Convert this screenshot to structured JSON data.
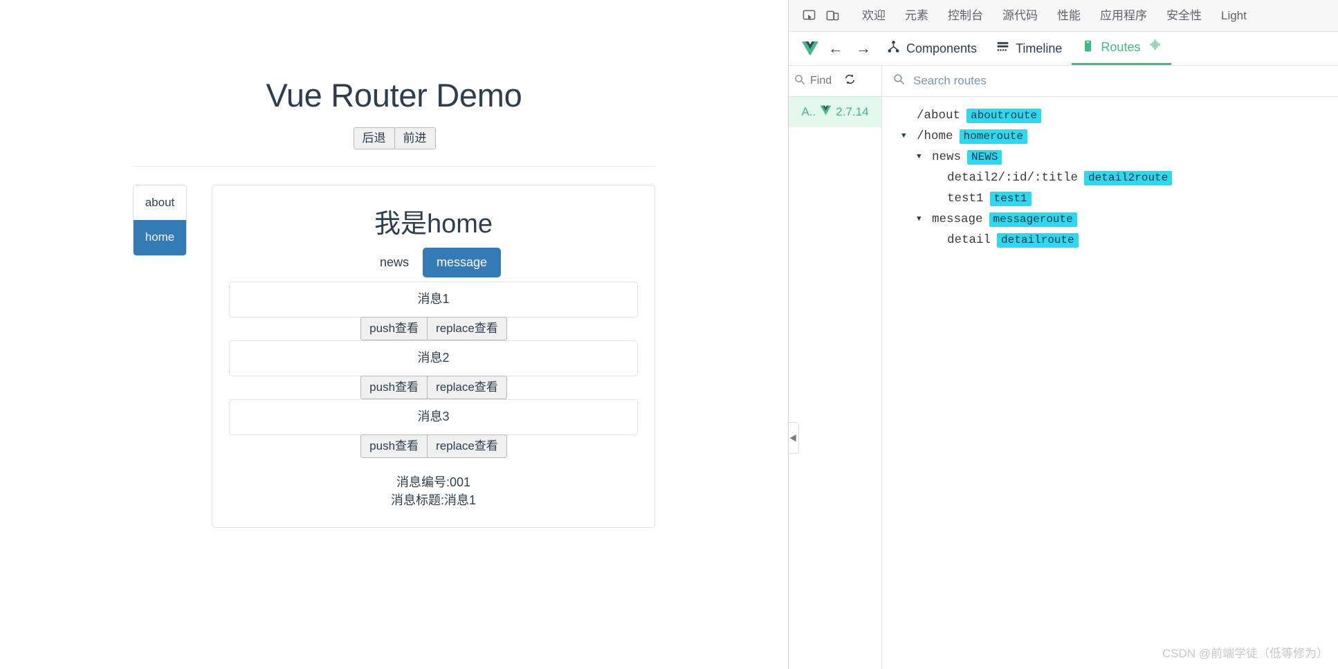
{
  "page": {
    "title": "Vue Router Demo",
    "history_buttons": [
      {
        "label": "后退",
        "name": "back-button"
      },
      {
        "label": "前进",
        "name": "forward-button"
      }
    ],
    "side_nav": [
      {
        "label": "about",
        "active": false
      },
      {
        "label": "home",
        "active": true
      }
    ],
    "view_title": "我是home",
    "sub_tabs": [
      {
        "label": "news",
        "active": false
      },
      {
        "label": "message",
        "active": true
      }
    ],
    "messages": [
      {
        "title": "消息1",
        "push_label": "push查看",
        "replace_label": "replace查看"
      },
      {
        "title": "消息2",
        "push_label": "push查看",
        "replace_label": "replace查看"
      },
      {
        "title": "消息3",
        "push_label": "push查看",
        "replace_label": "replace查看"
      }
    ],
    "detail": {
      "id_line": "消息编号:001",
      "title_line": "消息标题:消息1"
    }
  },
  "devtools": {
    "topbar": {
      "icons": [
        {
          "name": "inspect-element-icon"
        },
        {
          "name": "device-toolbar-icon"
        }
      ],
      "tabs": [
        {
          "label": "欢迎"
        },
        {
          "label": "元素"
        },
        {
          "label": "控制台"
        },
        {
          "label": "源代码"
        },
        {
          "label": "性能"
        },
        {
          "label": "应用程序"
        },
        {
          "label": "安全性"
        },
        {
          "label": "Light"
        }
      ]
    },
    "vuebar": {
      "back_arrow": "←",
      "forward_arrow": "→",
      "tabs": [
        {
          "label": "Components",
          "icon": "components-tree-icon",
          "active": false
        },
        {
          "label": "Timeline",
          "icon": "timeline-icon",
          "active": false
        },
        {
          "label": "Routes",
          "icon": "routes-icon",
          "active": true
        }
      ]
    },
    "instances": {
      "search_placeholder": "Find",
      "refresh_icon": "refresh-icon",
      "items": [
        {
          "prefix": "A..",
          "version": "2.7.14",
          "selected": true
        }
      ]
    },
    "routes": {
      "search_placeholder": "Search routes",
      "tree": [
        {
          "depth": 0,
          "caret": "",
          "path": "/about",
          "badge": "aboutroute"
        },
        {
          "depth": 0,
          "caret": "▼",
          "path": "/home",
          "badge": "homeroute"
        },
        {
          "depth": 1,
          "caret": "▼",
          "path": "news",
          "badge": "NEWS"
        },
        {
          "depth": 2,
          "caret": "",
          "path": "detail2/:id/:title",
          "badge": "detail2route"
        },
        {
          "depth": 2,
          "caret": "",
          "path": "test1",
          "badge": "test1"
        },
        {
          "depth": 1,
          "caret": "▼",
          "path": "message",
          "badge": "messageroute"
        },
        {
          "depth": 2,
          "caret": "",
          "path": "detail",
          "badge": "detailroute"
        }
      ]
    },
    "collapse_handle": "◀"
  },
  "watermark": "CSDN @前端学徒（低等修为）",
  "colors": {
    "accent_blue": "#337ab7",
    "vue_green": "#42b883",
    "badge_cyan": "#2ad9f2",
    "heading": "#2c3e50"
  }
}
